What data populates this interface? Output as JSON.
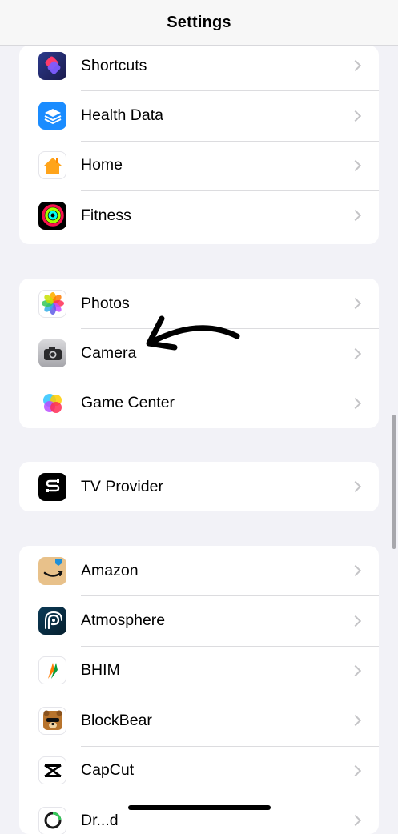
{
  "header": {
    "title": "Settings"
  },
  "groups": [
    {
      "items": [
        {
          "label": "Shortcuts",
          "icon": "shortcuts-icon"
        },
        {
          "label": "Health Data",
          "icon": "health-data-icon"
        },
        {
          "label": "Home",
          "icon": "home-icon"
        },
        {
          "label": "Fitness",
          "icon": "fitness-icon"
        }
      ]
    },
    {
      "items": [
        {
          "label": "Photos",
          "icon": "photos-icon"
        },
        {
          "label": "Camera",
          "icon": "camera-icon"
        },
        {
          "label": "Game Center",
          "icon": "game-center-icon"
        }
      ]
    },
    {
      "items": [
        {
          "label": "TV Provider",
          "icon": "tv-provider-icon"
        }
      ]
    },
    {
      "items": [
        {
          "label": "Amazon",
          "icon": "amazon-icon"
        },
        {
          "label": "Atmosphere",
          "icon": "atmosphere-icon"
        },
        {
          "label": "BHIM",
          "icon": "bhim-icon"
        },
        {
          "label": "BlockBear",
          "icon": "blockbear-icon"
        },
        {
          "label": "CapCut",
          "icon": "capcut-icon"
        },
        {
          "label": "Dr...d",
          "icon": "app-icon"
        }
      ]
    }
  ],
  "colors": {
    "background": "#f2f2f7",
    "separator": "#dcdcdf",
    "chevron": "#c4c4c7",
    "health_blue": "#1a8cff",
    "home_orange": "#ffa41b"
  },
  "annotation": {
    "icon": "hand-drawn-arrow-icon",
    "points_to": "Camera"
  }
}
